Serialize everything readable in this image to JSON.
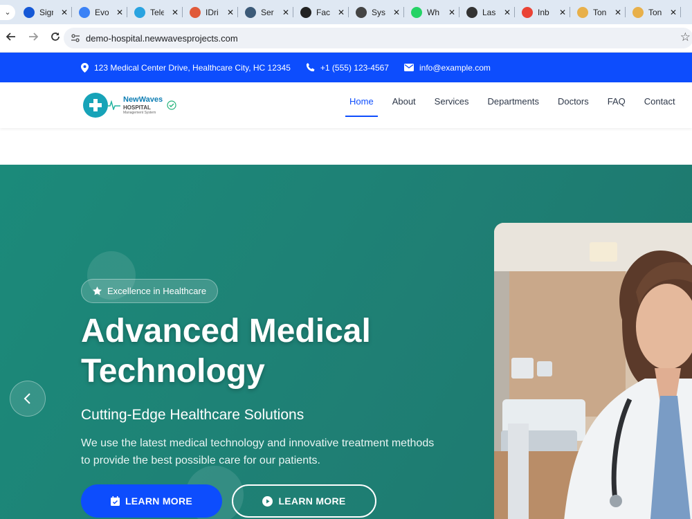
{
  "browser": {
    "tabs": [
      {
        "title": "Sign",
        "icon": "blue-moon-icon",
        "color": "#1558d6"
      },
      {
        "title": "Evo",
        "icon": "evo-icon",
        "color": "#3b82f6"
      },
      {
        "title": "Tele",
        "icon": "telegram-icon",
        "color": "#2aa3e0"
      },
      {
        "title": "IDri",
        "icon": "idrive-icon",
        "color": "#e05a3a"
      },
      {
        "title": "Ser",
        "icon": "wordpress-icon",
        "color": "#3c5a78"
      },
      {
        "title": "Faci",
        "icon": "facio-icon",
        "color": "#222222"
      },
      {
        "title": "Syst",
        "icon": "ethereum-icon",
        "color": "#444444"
      },
      {
        "title": "Wh",
        "icon": "whatsapp-icon",
        "color": "#25d366"
      },
      {
        "title": "Las",
        "icon": "last-icon",
        "color": "#333333"
      },
      {
        "title": "Inb",
        "icon": "gmail-icon",
        "color": "#ea4335"
      },
      {
        "title": "Ton",
        "icon": "ton-icon",
        "color": "#e8b04a"
      },
      {
        "title": "Ton",
        "icon": "ton-icon",
        "color": "#e8b04a"
      }
    ],
    "url": "demo-hospital.newwavesprojects.com"
  },
  "infobar": {
    "address": "123 Medical Center Drive, Healthcare City, HC 12345",
    "phone": "+1 (555) 123-4567",
    "email": "info@example.com"
  },
  "logo": {
    "line1": "NewWaves",
    "line2": "HOSPITAL",
    "line3": "Management System"
  },
  "nav": {
    "items": [
      "Home",
      "About",
      "Services",
      "Departments",
      "Doctors",
      "FAQ",
      "Contact"
    ],
    "active": "Home"
  },
  "hero": {
    "badge": "Excellence in Healthcare",
    "title": "Advanced Medical Technology",
    "subtitle": "Cutting-Edge Healthcare Solutions",
    "description": "We use the latest medical technology and innovative treatment methods to provide the best possible care for our patients.",
    "primary_button": "LEARN MORE",
    "secondary_button": "LEARN MORE"
  },
  "colors": {
    "brand_blue": "#0d4dfd",
    "hero_green": "#1b8a7a"
  }
}
